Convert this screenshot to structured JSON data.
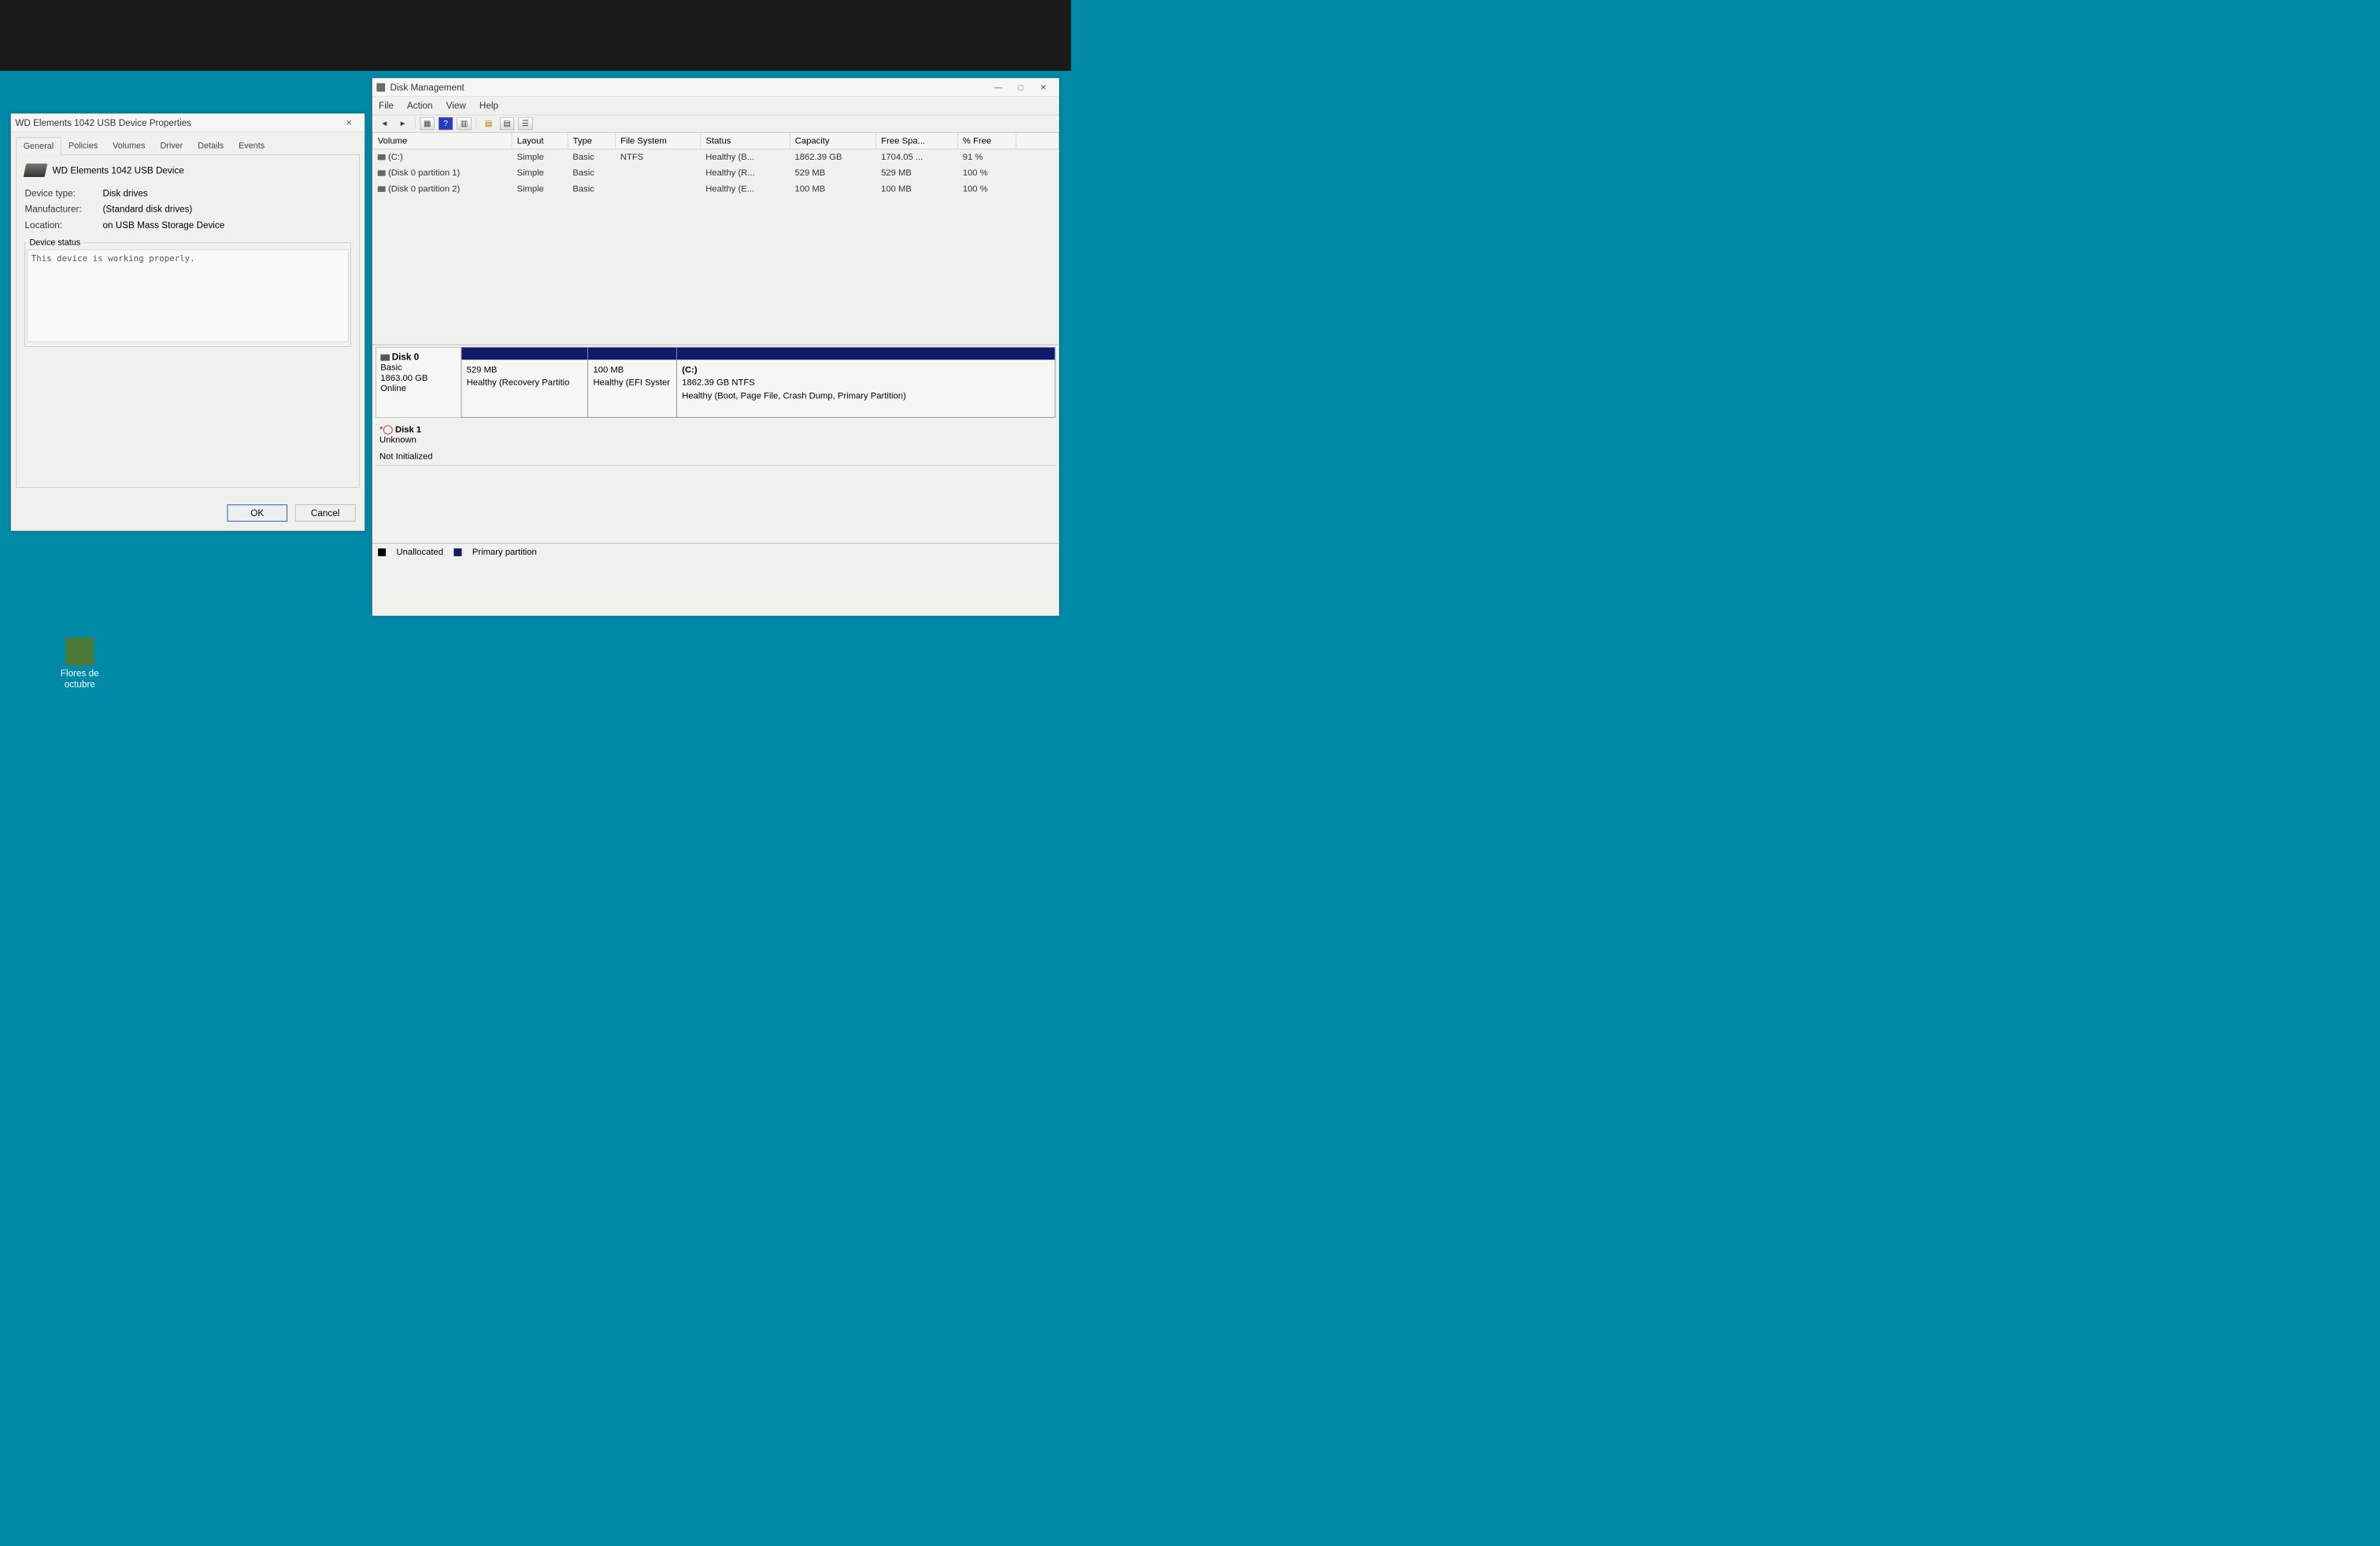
{
  "desktop": {
    "icons": [
      {
        "label": "Flores de octubre"
      }
    ]
  },
  "props": {
    "title": "WD Elements 1042 USB Device Properties",
    "tabs": [
      "General",
      "Policies",
      "Volumes",
      "Driver",
      "Details",
      "Events"
    ],
    "active_tab": "General",
    "device_name": "WD Elements 1042 USB Device",
    "fields": {
      "device_type_label": "Device type:",
      "device_type_value": "Disk drives",
      "manufacturer_label": "Manufacturer:",
      "manufacturer_value": "(Standard disk drives)",
      "location_label": "Location:",
      "location_value": "on USB Mass Storage Device"
    },
    "status_legend": "Device status",
    "status_text": "This device is working properly.",
    "ok_label": "OK",
    "cancel_label": "Cancel"
  },
  "dm": {
    "title": "Disk Management",
    "menus": [
      "File",
      "Action",
      "View",
      "Help"
    ],
    "cols": [
      "Volume",
      "Layout",
      "Type",
      "File System",
      "Status",
      "Capacity",
      "Free Spa...",
      "% Free"
    ],
    "volumes": [
      {
        "name": "(C:)",
        "layout": "Simple",
        "type": "Basic",
        "fs": "NTFS",
        "status": "Healthy (B...",
        "capacity": "1862.39 GB",
        "free": "1704.05 ...",
        "pct": "91 %"
      },
      {
        "name": "(Disk 0 partition 1)",
        "layout": "Simple",
        "type": "Basic",
        "fs": "",
        "status": "Healthy (R...",
        "capacity": "529 MB",
        "free": "529 MB",
        "pct": "100 %"
      },
      {
        "name": "(Disk 0 partition 2)",
        "layout": "Simple",
        "type": "Basic",
        "fs": "",
        "status": "Healthy (E...",
        "capacity": "100 MB",
        "free": "100 MB",
        "pct": "100 %"
      }
    ],
    "disk0": {
      "name": "Disk 0",
      "type": "Basic",
      "size": "1863.00 GB",
      "status": "Online",
      "parts": [
        {
          "title": "",
          "line1": "529 MB",
          "line2": "Healthy (Recovery Partitio",
          "flex": 2
        },
        {
          "title": "",
          "line1": "100 MB",
          "line2": "Healthy (EFI Syster",
          "flex": 1.4
        },
        {
          "title": "(C:)",
          "line1": "1862.39 GB NTFS",
          "line2": "Healthy (Boot, Page File, Crash Dump, Primary Partition)",
          "flex": 6
        }
      ]
    },
    "disk1": {
      "name": "Disk 1",
      "type": "Unknown",
      "status": "Not Initialized"
    },
    "legend": {
      "unallocated": "Unallocated",
      "primary": "Primary partition"
    }
  }
}
